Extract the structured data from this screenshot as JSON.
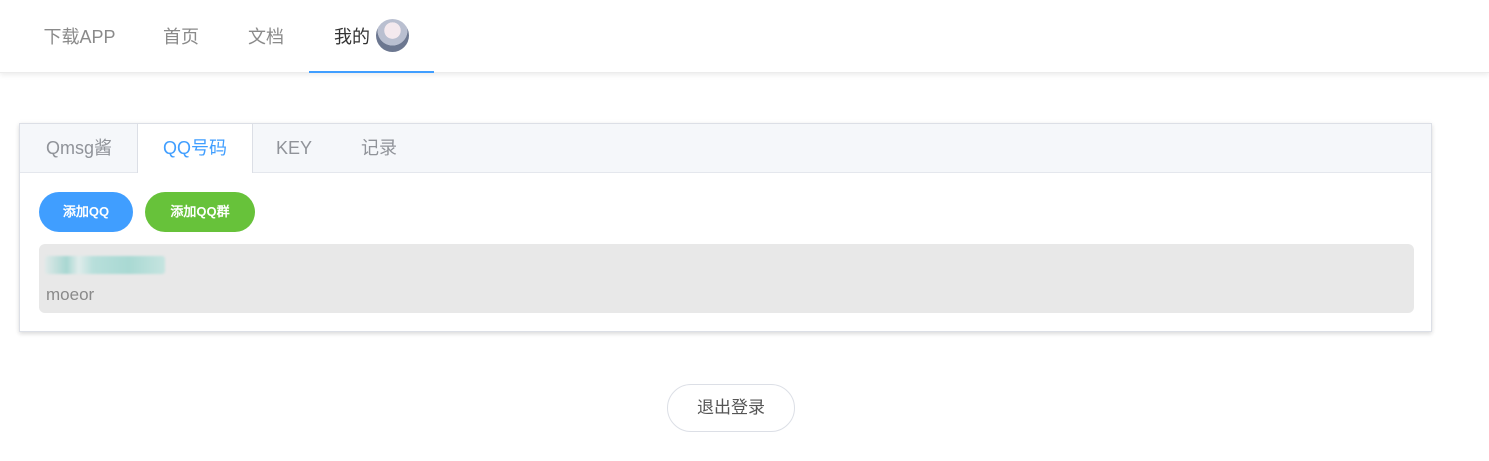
{
  "nav": {
    "items": [
      {
        "label": "下载APP"
      },
      {
        "label": "首页"
      },
      {
        "label": "文档"
      },
      {
        "label": "我的",
        "active": true,
        "icon": "user-avatar"
      }
    ],
    "accent_color": "#409eff"
  },
  "tabs": {
    "items": [
      {
        "label": "Qmsg酱"
      },
      {
        "label": "QQ号码",
        "active": true
      },
      {
        "label": "KEY"
      },
      {
        "label": "记录"
      }
    ]
  },
  "actions": {
    "add_qq_label": "添加QQ",
    "add_qq_color": "#409eff",
    "add_group_label": "添加QQ群",
    "add_group_color": "#67c23a"
  },
  "qq_list": [
    {
      "number_masked": true,
      "name": "moeor"
    }
  ],
  "logout_label": "退出登录"
}
